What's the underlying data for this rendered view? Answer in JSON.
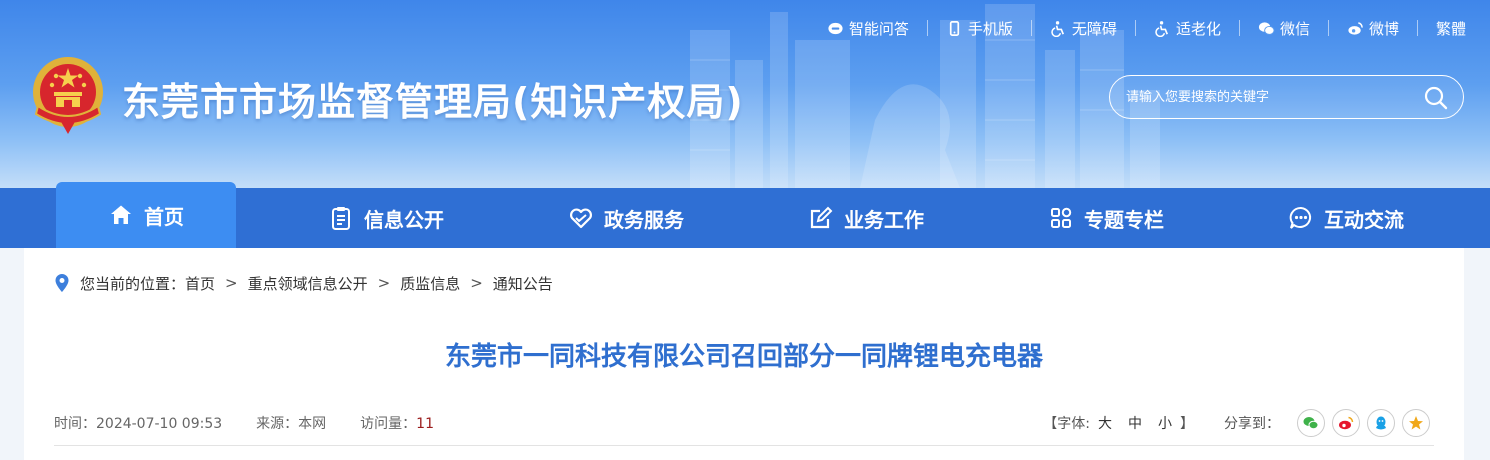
{
  "top_links": [
    {
      "label": "智能问答",
      "icon": "chat-bot-icon"
    },
    {
      "label": "手机版",
      "icon": "mobile-icon"
    },
    {
      "label": "无障碍",
      "icon": "accessibility-icon"
    },
    {
      "label": "适老化",
      "icon": "elderly-mode-icon"
    },
    {
      "label": "微信",
      "icon": "wechat-icon"
    },
    {
      "label": "微博",
      "icon": "weibo-icon"
    },
    {
      "label": "繁體",
      "icon": ""
    }
  ],
  "site": {
    "title": "东莞市市场监督管理局(知识产权局)"
  },
  "search": {
    "placeholder": "请输入您要搜索的关键字"
  },
  "nav": [
    {
      "label": "首页",
      "icon": "home-icon",
      "active": true
    },
    {
      "label": "信息公开",
      "icon": "clipboard-icon"
    },
    {
      "label": "政务服务",
      "icon": "heart-hands-icon"
    },
    {
      "label": "业务工作",
      "icon": "edit-icon"
    },
    {
      "label": "专题专栏",
      "icon": "grid-icon"
    },
    {
      "label": "互动交流",
      "icon": "chat-bubble-icon"
    }
  ],
  "breadcrumb": {
    "prefix": "您当前的位置：",
    "items": [
      "首页",
      "重点领域信息公开",
      "质监信息",
      "通知公告"
    ],
    "separator": ">"
  },
  "article": {
    "title": "东莞市一同科技有限公司召回部分一同牌锂电充电器",
    "time_label": "时间：",
    "time": "2024-07-10 09:53",
    "source_label": "来源：",
    "source": "本网",
    "views_label": "访问量：",
    "views": "11"
  },
  "tools": {
    "font_label": "【字体:",
    "font_large": "大",
    "font_medium": "中",
    "font_small": "小",
    "font_close": "】",
    "share_label": "分享到："
  },
  "share_buttons": [
    {
      "icon": "wechat-share-icon",
      "color": "#3fb24a"
    },
    {
      "icon": "weibo-share-icon",
      "color": "#e6162d"
    },
    {
      "icon": "qq-share-icon",
      "color": "#1aa1e6"
    },
    {
      "icon": "favorite-star-icon",
      "color": "#f0a81a"
    }
  ],
  "colors": {
    "header_top": "#3f86ea",
    "nav_bg": "#2f6fd4",
    "nav_active": "#3d8df2",
    "title_blue": "#2f6fcf",
    "views_count": "#9b1c1c"
  }
}
